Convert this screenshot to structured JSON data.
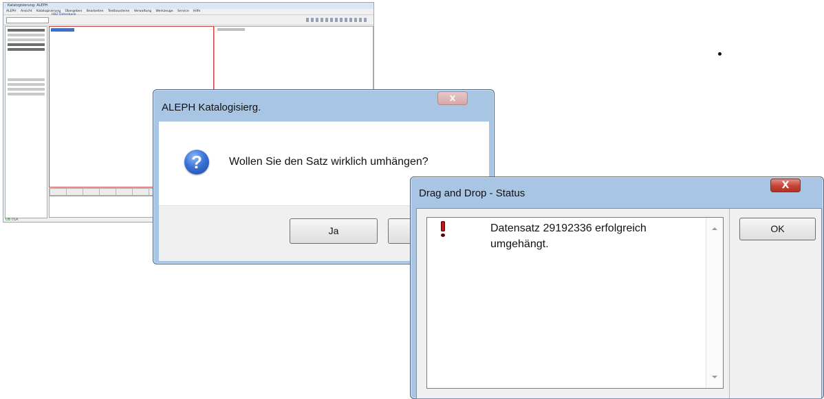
{
  "background_app": {
    "title": "Katalogisierung: ALEPH",
    "menu": [
      "ALEPH",
      "Ansicht",
      "Katalogisierung",
      "Übergeben",
      "Bearbeiten",
      "Textbausteine",
      "Verwaltung",
      "Werkzeuge",
      "Service",
      "Hilfe"
    ],
    "note": "HBZ Datenbank",
    "status_text": "UB 01A"
  },
  "aleph_dialog": {
    "title": "ALEPH Katalogisierg.",
    "close_glyph": "x",
    "question_glyph": "?",
    "message": "Wollen Sie den Satz wirklich umhängen?",
    "yes_label": "Ja",
    "no_label": ""
  },
  "status_dialog": {
    "title": "Drag and Drop - Status",
    "close_glyph": "X",
    "message": "Datensatz 29192336 erfolgreich umgehängt.",
    "ok_label": "OK"
  },
  "colors": {
    "title_active": "#a9c5e4",
    "close_red": "#c24335",
    "question_blue": "#3b73d6",
    "alert_red": "#c01818"
  },
  "icons": [
    "question-icon",
    "exclamation-icon",
    "close-icon",
    "scroll-up-icon",
    "scroll-down-icon"
  ]
}
